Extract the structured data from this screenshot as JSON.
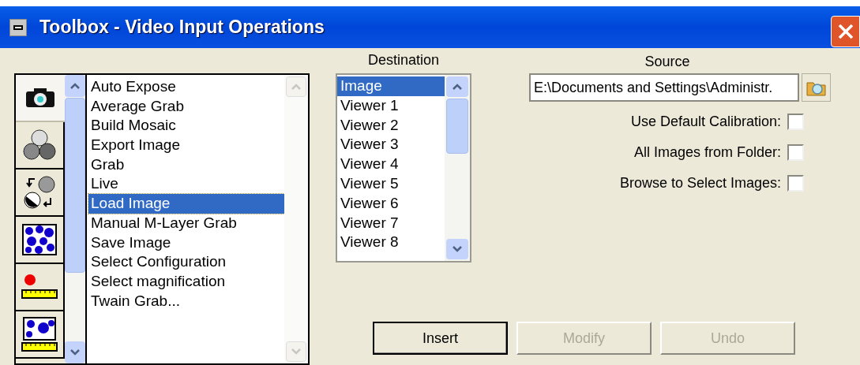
{
  "window": {
    "title": "Toolbox - Video Input Operations"
  },
  "tool_tabs": [
    {
      "kind": "camera",
      "selected": true
    },
    {
      "kind": "circles",
      "selected": false
    },
    {
      "kind": "rotate",
      "selected": false
    },
    {
      "kind": "blobs",
      "selected": false
    },
    {
      "kind": "marker",
      "selected": false
    },
    {
      "kind": "blobs-ruler",
      "selected": false
    }
  ],
  "operations": [
    {
      "label": "Auto Expose",
      "selected": false
    },
    {
      "label": "Average Grab",
      "selected": false
    },
    {
      "label": "Build Mosaic",
      "selected": false
    },
    {
      "label": "Export Image",
      "selected": false
    },
    {
      "label": "Grab",
      "selected": false
    },
    {
      "label": "Live",
      "selected": false
    },
    {
      "label": "Load Image",
      "selected": true
    },
    {
      "label": "Manual M-Layer Grab",
      "selected": false
    },
    {
      "label": "Save Image",
      "selected": false
    },
    {
      "label": "Select Configuration",
      "selected": false
    },
    {
      "label": "Select magnification",
      "selected": false
    },
    {
      "label": "Twain Grab...",
      "selected": false
    }
  ],
  "destination": {
    "label": "Destination",
    "items": [
      {
        "label": "Image",
        "selected": true
      },
      {
        "label": "Viewer 1",
        "selected": false
      },
      {
        "label": "Viewer 2",
        "selected": false
      },
      {
        "label": "Viewer 3",
        "selected": false
      },
      {
        "label": "Viewer 4",
        "selected": false
      },
      {
        "label": "Viewer 5",
        "selected": false
      },
      {
        "label": "Viewer 6",
        "selected": false
      },
      {
        "label": "Viewer 7",
        "selected": false
      },
      {
        "label": "Viewer 8",
        "selected": false
      }
    ]
  },
  "source": {
    "label": "Source",
    "value": "E:\\Documents and Settings\\Administr."
  },
  "options": [
    {
      "label": "Use Default Calibration:",
      "checked": false
    },
    {
      "label": "All Images from Folder:",
      "checked": false
    },
    {
      "label": "Browse to Select Images:",
      "checked": false
    }
  ],
  "buttons": [
    {
      "label": "Insert",
      "disabled": false
    },
    {
      "label": "Modify",
      "disabled": true
    },
    {
      "label": "Undo",
      "disabled": true
    }
  ]
}
